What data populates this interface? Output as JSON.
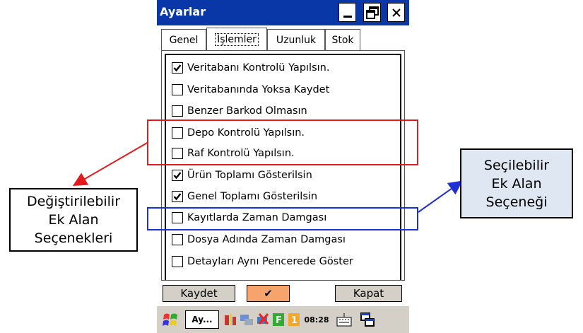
{
  "window": {
    "title": "Ayarlar",
    "controls": {
      "minimize_icon": "minimize-icon",
      "restore_icon": "restore-icon",
      "close_icon": "close-icon"
    }
  },
  "tabs": [
    {
      "label": "Genel",
      "active": false
    },
    {
      "label": "İşlemler",
      "active": true
    },
    {
      "label": "Uzunluk",
      "active": false
    },
    {
      "label": "Stok",
      "active": false
    }
  ],
  "options": [
    {
      "label": "Veritabanı Kontrolü Yapılsın.",
      "checked": true
    },
    {
      "label": "Veritabanında Yoksa Kaydet",
      "checked": false
    },
    {
      "label": "Benzer Barkod Olmasın",
      "checked": false
    },
    {
      "label": "Depo Kontrolü Yapılsın.",
      "checked": false
    },
    {
      "label": "Raf Kontrolü Yapılsın.",
      "checked": false
    },
    {
      "label": "Ürün Toplamı Gösterilsin",
      "checked": true
    },
    {
      "label": "Genel Toplamı Gösterilsin",
      "checked": true
    },
    {
      "label": "Kayıtlarda Zaman Damgası",
      "checked": false
    },
    {
      "label": "Dosya Adında Zaman Damgası",
      "checked": false
    },
    {
      "label": "Detayları Aynı Pencerede Göster",
      "checked": false
    }
  ],
  "buttons": {
    "save_label": "Kaydet",
    "ok_symbol": "✔",
    "close_label": "Kapat",
    "accent_color": "#f7a36c"
  },
  "taskbar": {
    "app_label": "Ay...",
    "time": "08:28",
    "icons": [
      "start-flag-icon",
      "signal-icon",
      "network-icon",
      "sync-off-icon",
      "f-key-icon",
      "numeric-one-icon",
      "keyboard-icon",
      "window-switch-icon"
    ]
  },
  "annotations": {
    "left_callout": [
      "Değiştirilebilir",
      "Ek Alan",
      "Seçenekleri"
    ],
    "right_callout": [
      "Seçilebilir",
      "Ek Alan",
      "Seçeneği"
    ],
    "left_color": "#e31a1c",
    "right_color": "#1f2fd6"
  },
  "colors": {
    "titlebar": "#0a37a8",
    "chrome": "#d4d0c8"
  }
}
